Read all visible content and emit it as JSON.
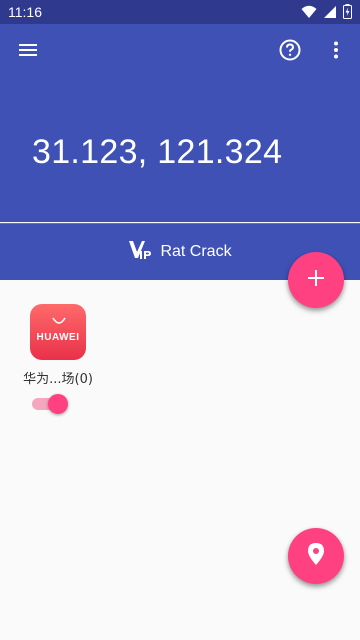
{
  "status_bar": {
    "time": "11:16"
  },
  "header": {
    "coordinates": "31.123, 121.324"
  },
  "vip_banner": {
    "label": "Rat Crack"
  },
  "apps": [
    {
      "icon_label": "HUAWEI",
      "name": "华为...场(0)",
      "enabled": true
    }
  ],
  "colors": {
    "primary": "#3f51b5",
    "status_bar": "#2f3a8f",
    "accent": "#ff4081"
  },
  "icons": {
    "menu": "menu-icon",
    "help": "help-icon",
    "more": "more-vert-icon",
    "vip": "vip-icon",
    "add": "add-icon",
    "location": "location-pin-icon"
  }
}
